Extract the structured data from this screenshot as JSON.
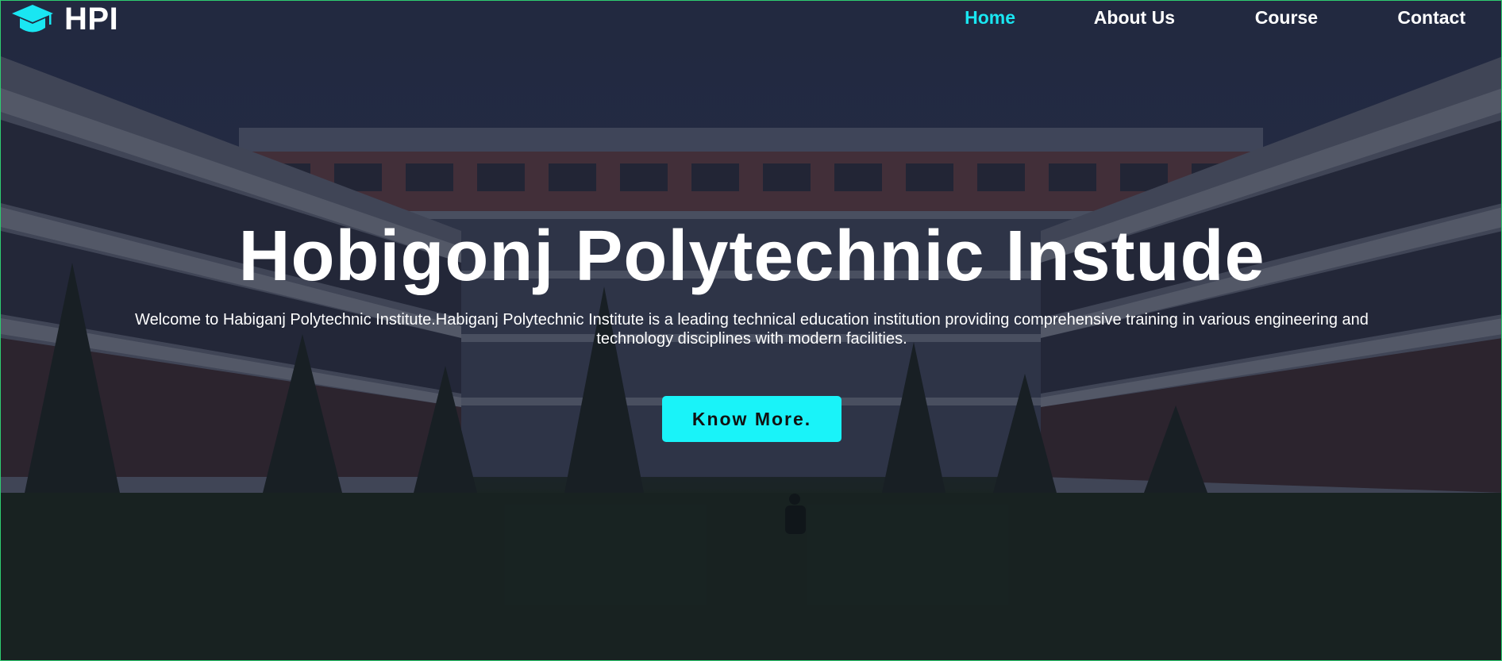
{
  "header": {
    "logo_icon": "graduation-cap-icon",
    "logo_text": "HPI",
    "nav": [
      {
        "label": "Home",
        "active": true
      },
      {
        "label": "About Us",
        "active": false
      },
      {
        "label": "Course",
        "active": false
      },
      {
        "label": "Contact",
        "active": false
      }
    ]
  },
  "hero": {
    "title": "Hobigonj Polytechnic Instude",
    "description": "Welcome to Habiganj Polytechnic Institute.Habiganj Polytechnic Institute is a leading technical education institution providing comprehensive training in various engineering and technology disciplines with modern facilities.",
    "cta_label": "Know More."
  },
  "colors": {
    "accent": "#19e6f2",
    "button": "#19f3f9",
    "text": "#ffffff"
  }
}
